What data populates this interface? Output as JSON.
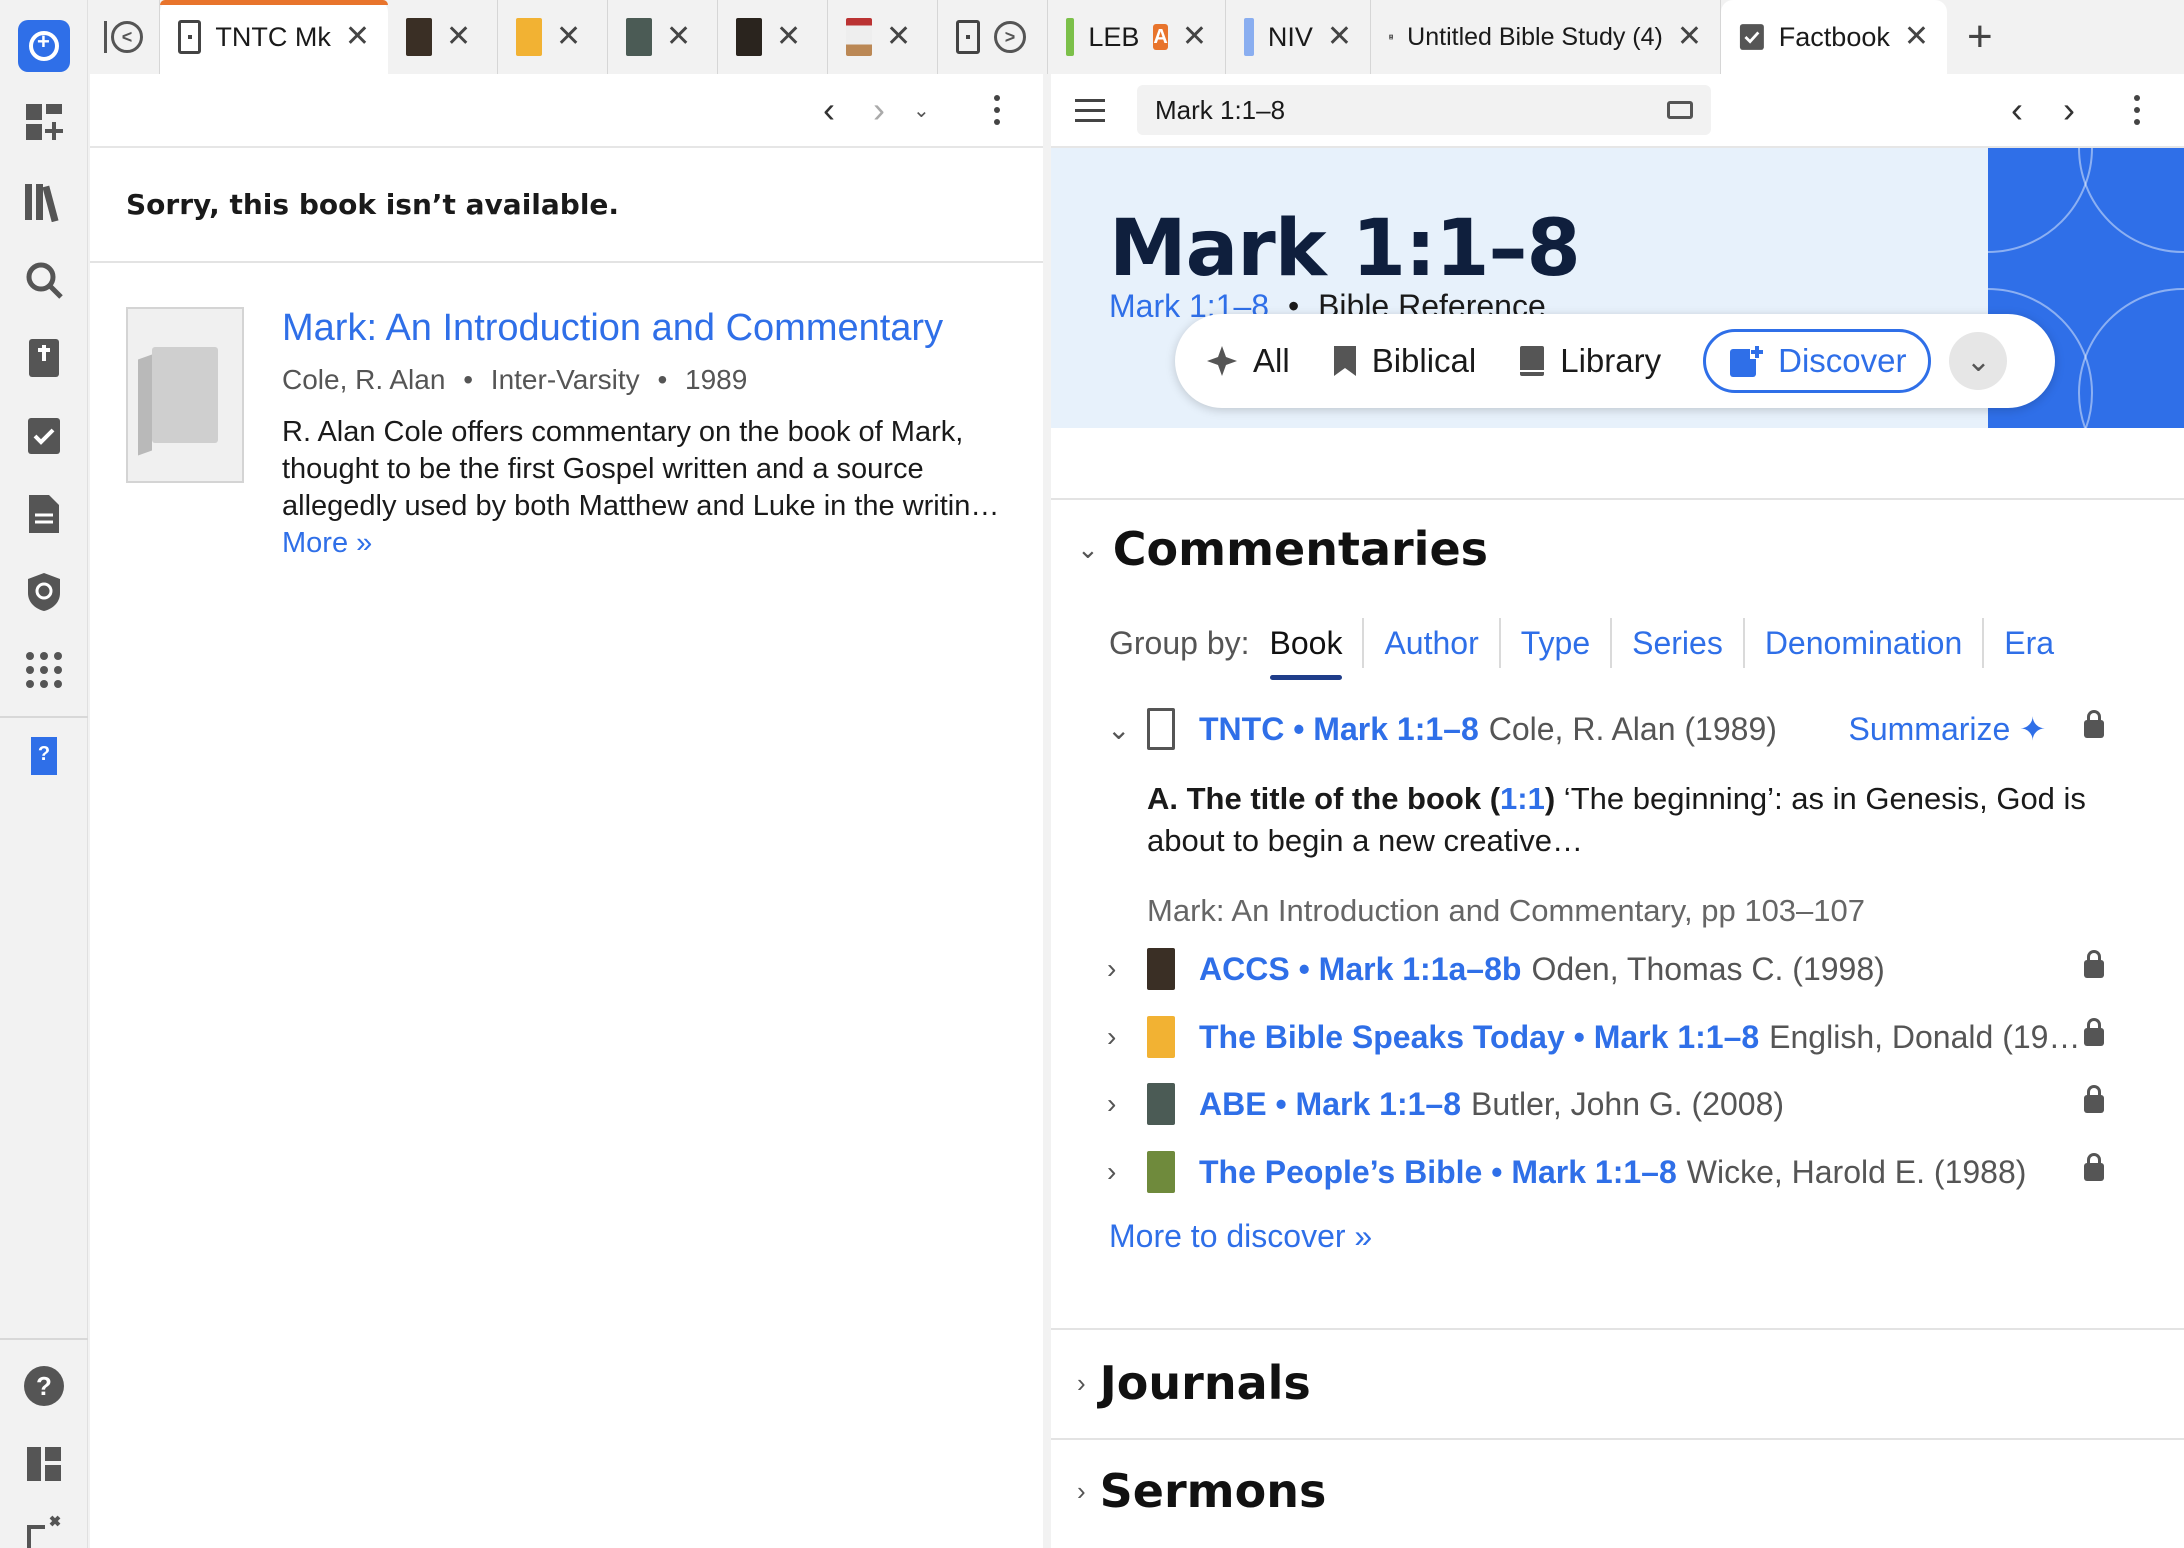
{
  "tabs": {
    "tnct_label": "TNTC Mk",
    "leb_label": "LEB",
    "leb_badge": "A",
    "niv_label": "NIV",
    "study_label": "Untitled Bible Study (4)",
    "factbook_label": "Factbook",
    "close": "✕",
    "new_tab": "+"
  },
  "left": {
    "error": "Sorry, this book isn’t available.",
    "book_title": "Mark: An Introduction and Commentary",
    "author": "Cole, R. Alan",
    "publisher": "Inter-Varsity",
    "year": "1989",
    "meta_sep": "•",
    "description": "R. Alan Cole offers commentary on the book of Mark, thought to be the first Gospel written and a source allegedly used by both Matthew and Luke in the writin…",
    "more": "More »"
  },
  "right": {
    "reference": "Mark 1:1–8",
    "hero_title": "Mark 1:1–8",
    "hero_ref_link": "Mark 1:1–8",
    "hero_sep": "•",
    "hero_type": "Bible Reference",
    "segments": [
      "All",
      "Biblical",
      "Library",
      "Discover"
    ],
    "section_commentaries": "Commentaries",
    "group_by_label": "Group by:",
    "group_by": [
      "Book",
      "Author",
      "Type",
      "Series",
      "Denomination",
      "Era"
    ],
    "summarize": "Summarize",
    "rows": [
      {
        "title": "TNTC • Mark 1:1–8",
        "author": "Cole, R. Alan (1989)",
        "color": "#ffffff"
      },
      {
        "title": "ACCS • Mark 1:1a–8b",
        "author": "Oden, Thomas C. (1998)",
        "color": "#3a2f25"
      },
      {
        "title": "The Bible Speaks Today • Mark 1:1–8",
        "author": "English, Donald (19…",
        "color": "#f2b233"
      },
      {
        "title": "ABE • Mark 1:1–8",
        "author": "Butler, John G. (2008)",
        "color": "#4b5b55"
      },
      {
        "title": "The People’s Bible • Mark 1:1–8",
        "author": "Wicke, Harold E. (1988)",
        "color": "#6f8a3c"
      }
    ],
    "excerpt_bold": "A. The title of the book (",
    "excerpt_ref": "1:1",
    "excerpt_bold_end": ")",
    "excerpt_text": " ‘The beginning’: as in Genesis, God is about to begin a new creative…",
    "excerpt_source": "Mark: An Introduction and Commentary, pp 103–107",
    "more_discover": "More to discover »",
    "section_journals": "Journals",
    "section_sermons": "Sermons"
  },
  "colors": {
    "accent": "#2f6fe8",
    "tab_active_bar": "#e8742c",
    "hero_bg": "#e7f1fb",
    "hero_title": "#0f1f3d"
  }
}
